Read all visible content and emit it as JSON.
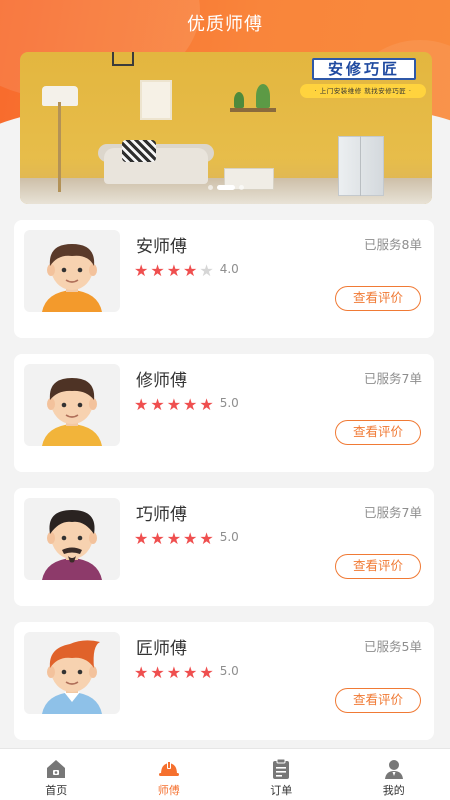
{
  "header": {
    "title": "优质师傅"
  },
  "banner": {
    "brand_name": "安修巧匠",
    "slogan": "· 上门安装维修    就找安修巧匠 ·",
    "page_count": 3,
    "active_page": 2
  },
  "masters": [
    {
      "name": "安师傅",
      "served": "已服务8单",
      "rating_value": 4,
      "rating_text": "4.0",
      "review_label": "查看评价",
      "avatar": "boy-orange-shirt"
    },
    {
      "name": "修师傅",
      "served": "已服务7单",
      "rating_value": 5,
      "rating_text": "5.0",
      "review_label": "查看评价",
      "avatar": "boy-yellow-shirt"
    },
    {
      "name": "巧师傅",
      "served": "已服务7单",
      "rating_value": 5,
      "rating_text": "5.0",
      "review_label": "查看评价",
      "avatar": "man-beard-purple-shirt"
    },
    {
      "name": "匠师傅",
      "served": "已服务5单",
      "rating_value": 5,
      "rating_text": "5.0",
      "review_label": "查看评价",
      "avatar": "boy-red-hair-blue-shirt"
    }
  ],
  "tabbar": {
    "items": [
      {
        "label": "首页",
        "icon": "home-icon",
        "active": false
      },
      {
        "label": "师傅",
        "icon": "hardhat-icon",
        "active": true
      },
      {
        "label": "订单",
        "icon": "clipboard-icon",
        "active": false
      },
      {
        "label": "我的",
        "icon": "profile-icon",
        "active": false
      }
    ]
  },
  "colors": {
    "accent": "#f5702e",
    "star_on": "#ef4f4f",
    "star_off": "#d6d6d6",
    "tab_inactive": "#777777",
    "button_border": "#f07a35"
  }
}
